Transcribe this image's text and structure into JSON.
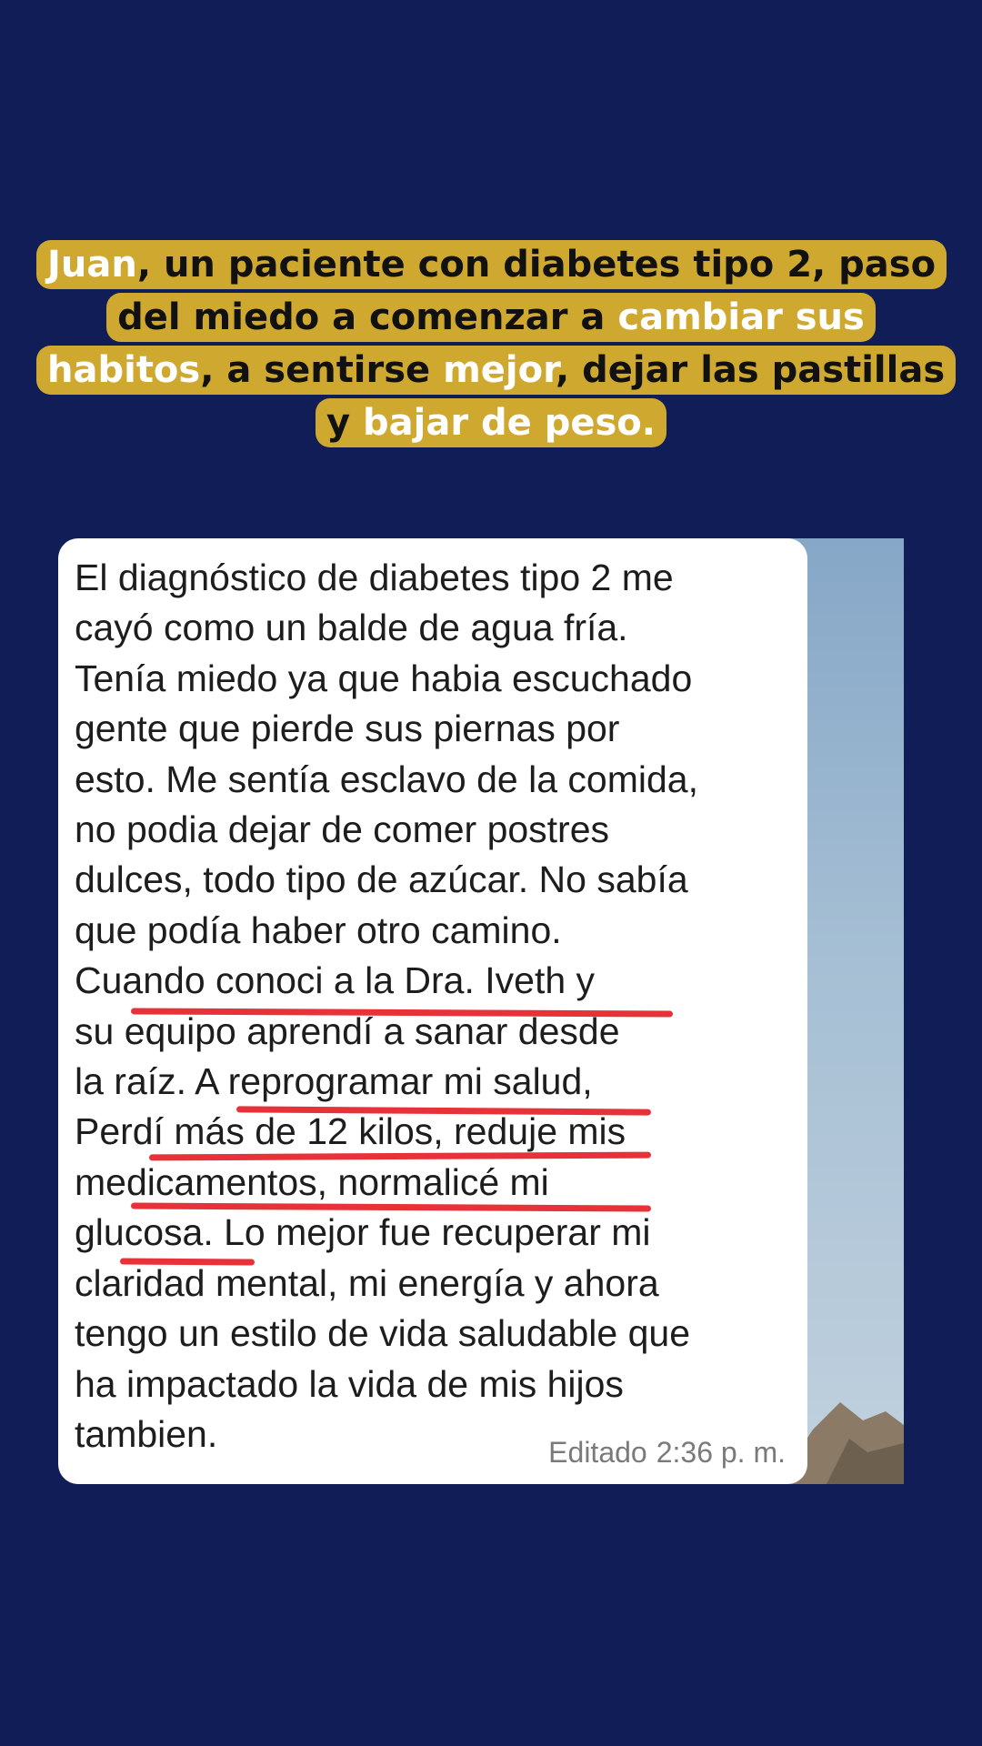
{
  "headline": {
    "parts": [
      {
        "text": "Juan",
        "highlight": true
      },
      {
        "text": ", un paciente con diabetes tipo 2, paso del miedo a comenzar a ",
        "highlight": false
      },
      {
        "text": "cambiar sus habitos",
        "highlight": true
      },
      {
        "text": ", a sentirse ",
        "highlight": false
      },
      {
        "text": "mejor",
        "highlight": true
      },
      {
        "text": ", dejar las pastillas y ",
        "highlight": false
      },
      {
        "text": "bajar de peso.",
        "highlight": true
      }
    ]
  },
  "message": {
    "lines": [
      "El diagnóstico de diabetes tipo 2 me",
      "cayó como un balde de agua fría.",
      "Tenía miedo ya que habia escuchado",
      "gente que pierde sus piernas por",
      "esto. Me sentía esclavo de la comida,",
      "no podia dejar de comer postres",
      "dulces, todo tipo de azúcar.  No sabía",
      "que podía haber otro camino.",
      "Cuando conoci a la Dra. Iveth y",
      "su equipo aprendí a sanar desde",
      "la raíz. A reprogramar mi salud,",
      "Perdí más de 12 kilos, reduje mis",
      "medicamentos, normalicé mi",
      "glucosa. Lo mejor fue recuperar mi",
      "claridad mental, mi energía y ahora",
      "tengo un estilo de vida saludable que",
      "ha impactado la vida de mis hijos",
      "tambien."
    ],
    "edited_label": "Editado",
    "time": "2:36 p. m."
  },
  "colors": {
    "background": "#111d57",
    "headline_box": "#cfa92f",
    "headline_highlight": "#ffffff",
    "underline": "#e8323a"
  }
}
